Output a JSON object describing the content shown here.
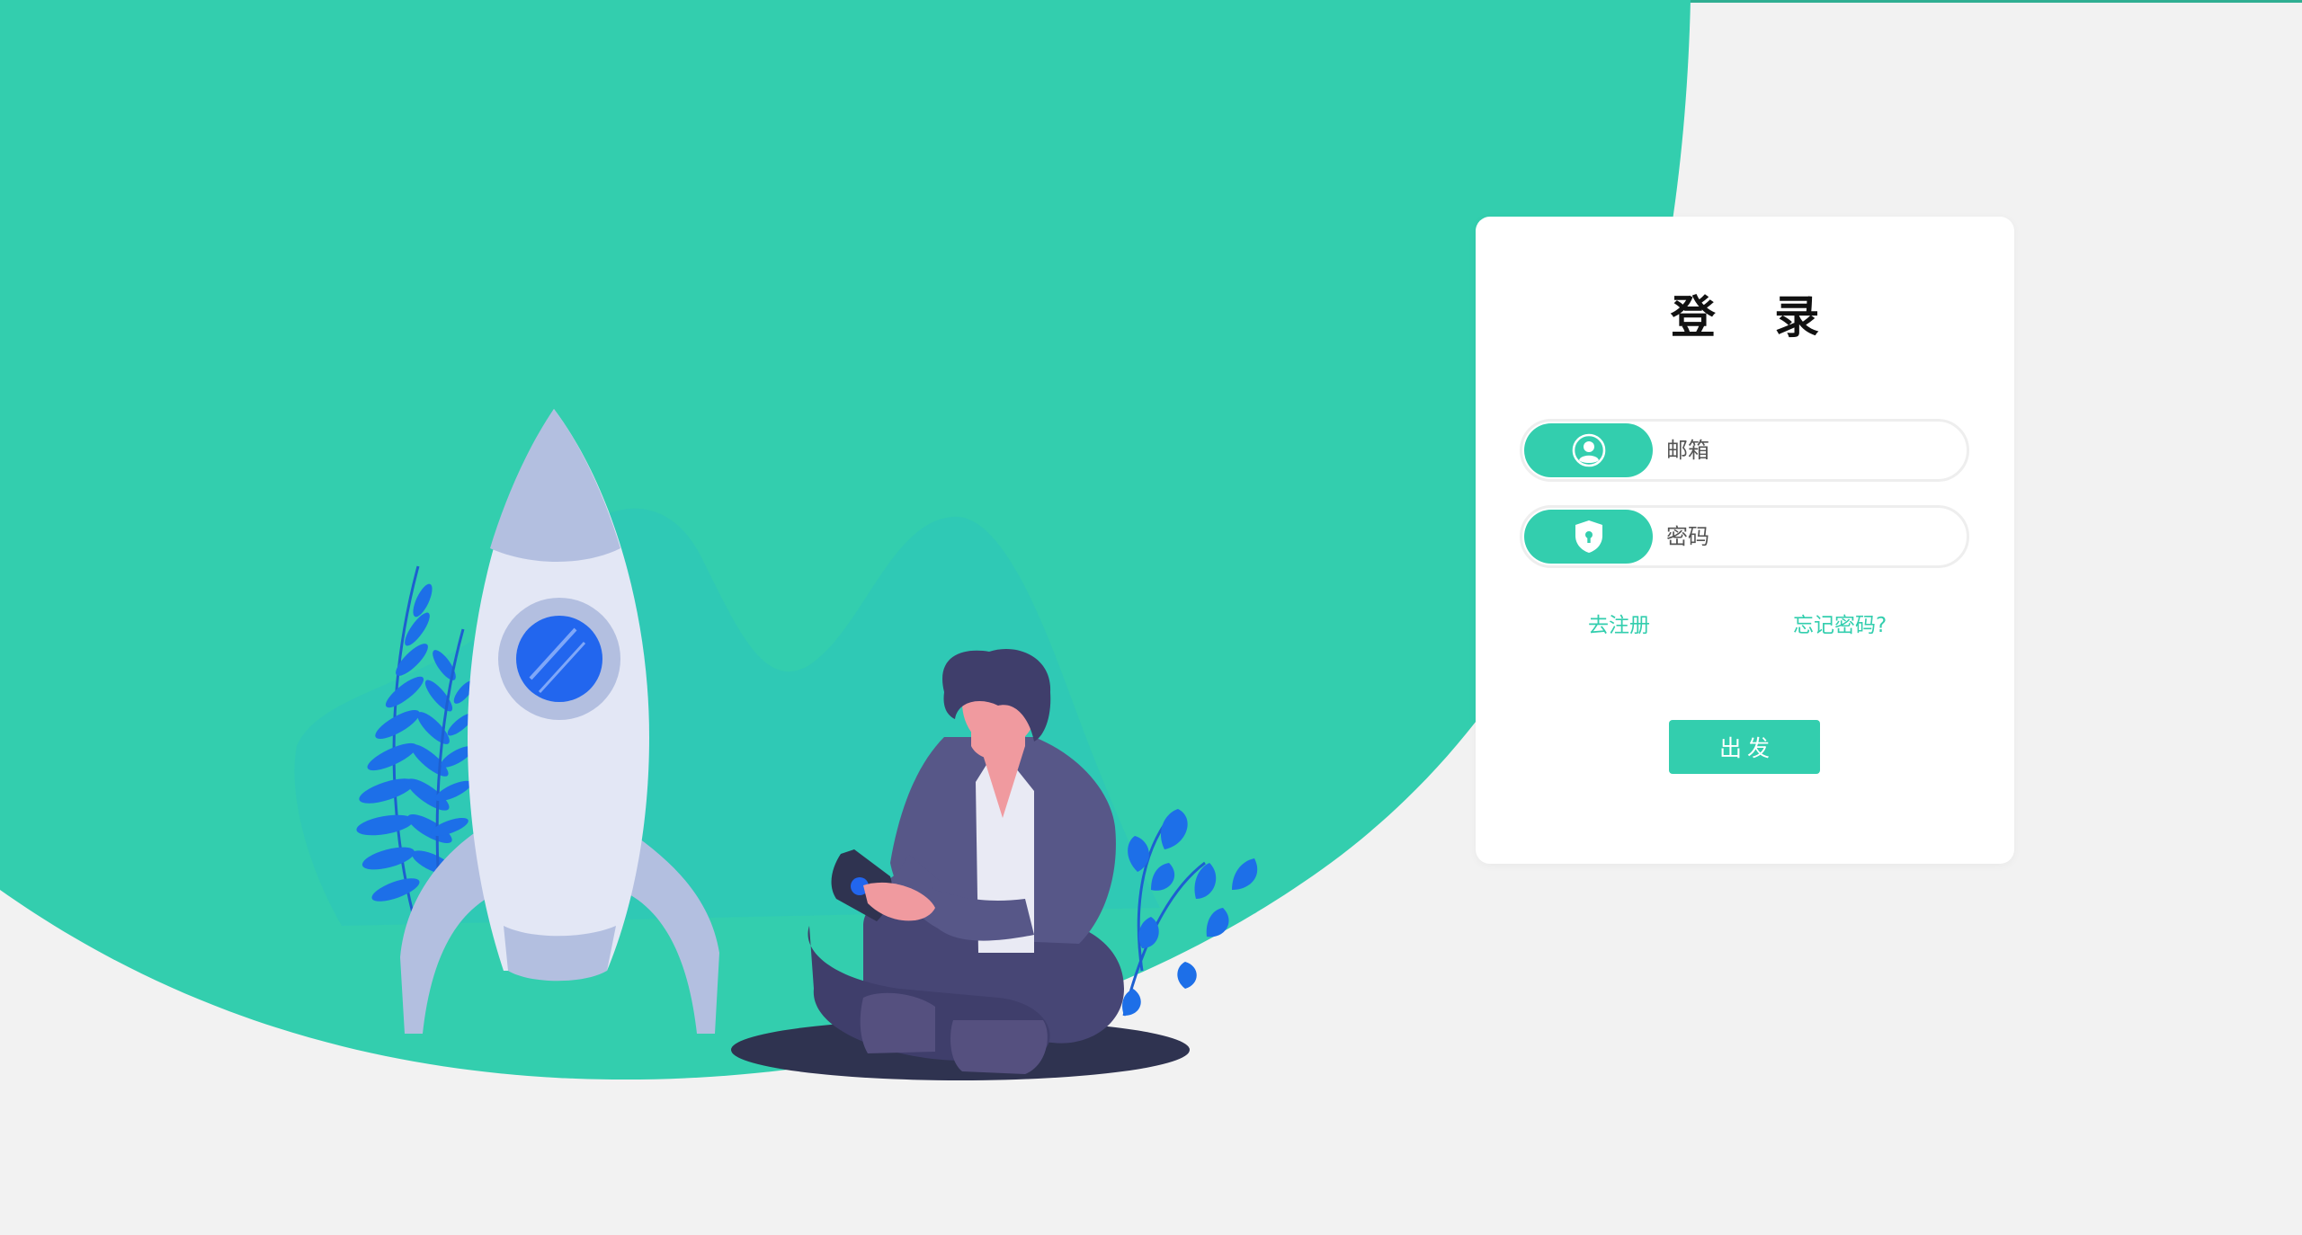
{
  "colors": {
    "accent": "#33ceae",
    "page_background": "#f2f2f2",
    "card_background": "#ffffff"
  },
  "login": {
    "title": "登 录",
    "email": {
      "icon": "user-icon",
      "placeholder": "邮箱",
      "value": ""
    },
    "password": {
      "icon": "shield-lock-icon",
      "placeholder": "密码",
      "value": ""
    },
    "register_link": "去注册",
    "forgot_link": "忘记密码?",
    "submit_label": "出发"
  },
  "illustration": {
    "icon": "rocket-launch-illustration"
  }
}
